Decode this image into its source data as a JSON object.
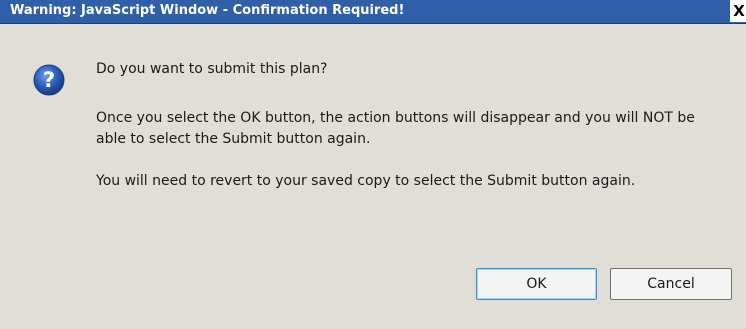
{
  "dialog": {
    "title": "Warning: JavaScript Window - Confirmation Required!",
    "close_label": "X",
    "icon": "question-icon",
    "question": "Do you want to submit this plan?",
    "paragraph1": "Once you select the OK button, the action buttons will disappear and you will NOT be able to select the Submit button again.",
    "paragraph2": "You will need to revert to your saved copy to select the Submit button again.",
    "ok_label": "OK",
    "cancel_label": "Cancel"
  },
  "colors": {
    "titlebar": "#2e5fa8",
    "background": "#e1ded8",
    "icon_blue": "#2a5bb5"
  }
}
